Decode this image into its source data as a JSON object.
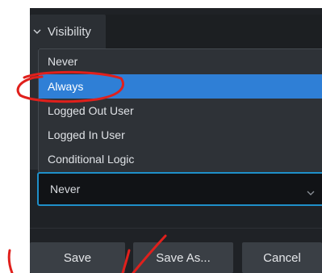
{
  "visibility": {
    "section_label": "Visibility",
    "options": [
      "Never",
      "Always",
      "Logged Out User",
      "Logged In User",
      "Conditional Logic"
    ],
    "highlighted_option": "Always",
    "selected_value": "Never"
  },
  "buttons": {
    "save": "Save",
    "save_as": "Save As...",
    "cancel": "Cancel"
  },
  "colors": {
    "panel_bg": "#1f2226",
    "highlight": "#2f7fd6",
    "focus_border": "#1f8fc9",
    "annotation": "#e0201c"
  }
}
